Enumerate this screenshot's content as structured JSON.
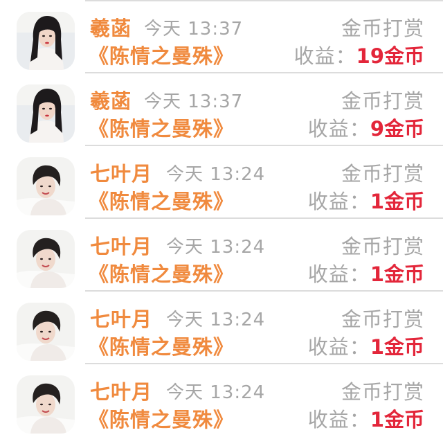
{
  "colors": {
    "accent_orange": "#f08a3e",
    "muted_gray": "#a6a6a6",
    "amount_red": "#e3263a",
    "divider": "#dcdcdc"
  },
  "rows": [
    {
      "name": "羲菡",
      "time": "今天  13:37",
      "reward": "金币打赏",
      "novel": "《陈情之曼殊》",
      "earn_label": "收益：",
      "amount": "19金币",
      "avatar": "woman-portrait"
    },
    {
      "name": "羲菡",
      "time": "今天  13:37",
      "reward": "金币打赏",
      "novel": "《陈情之曼殊》",
      "earn_label": "收益：",
      "amount": "9金币",
      "avatar": "woman-portrait"
    },
    {
      "name": "七叶月",
      "time": "今天  13:24",
      "reward": "金币打赏",
      "novel": "《陈情之曼殊》",
      "earn_label": "收益：",
      "amount": "1金币",
      "avatar": "man-portrait"
    },
    {
      "name": "七叶月",
      "time": "今天  13:24",
      "reward": "金币打赏",
      "novel": "《陈情之曼殊》",
      "earn_label": "收益：",
      "amount": "1金币",
      "avatar": "man-portrait"
    },
    {
      "name": "七叶月",
      "time": "今天  13:24",
      "reward": "金币打赏",
      "novel": "《陈情之曼殊》",
      "earn_label": "收益：",
      "amount": "1金币",
      "avatar": "man-portrait"
    },
    {
      "name": "七叶月",
      "time": "今天  13:24",
      "reward": "金币打赏",
      "novel": "《陈情之曼殊》",
      "earn_label": "收益：",
      "amount": "1金币",
      "avatar": "man-portrait"
    }
  ]
}
